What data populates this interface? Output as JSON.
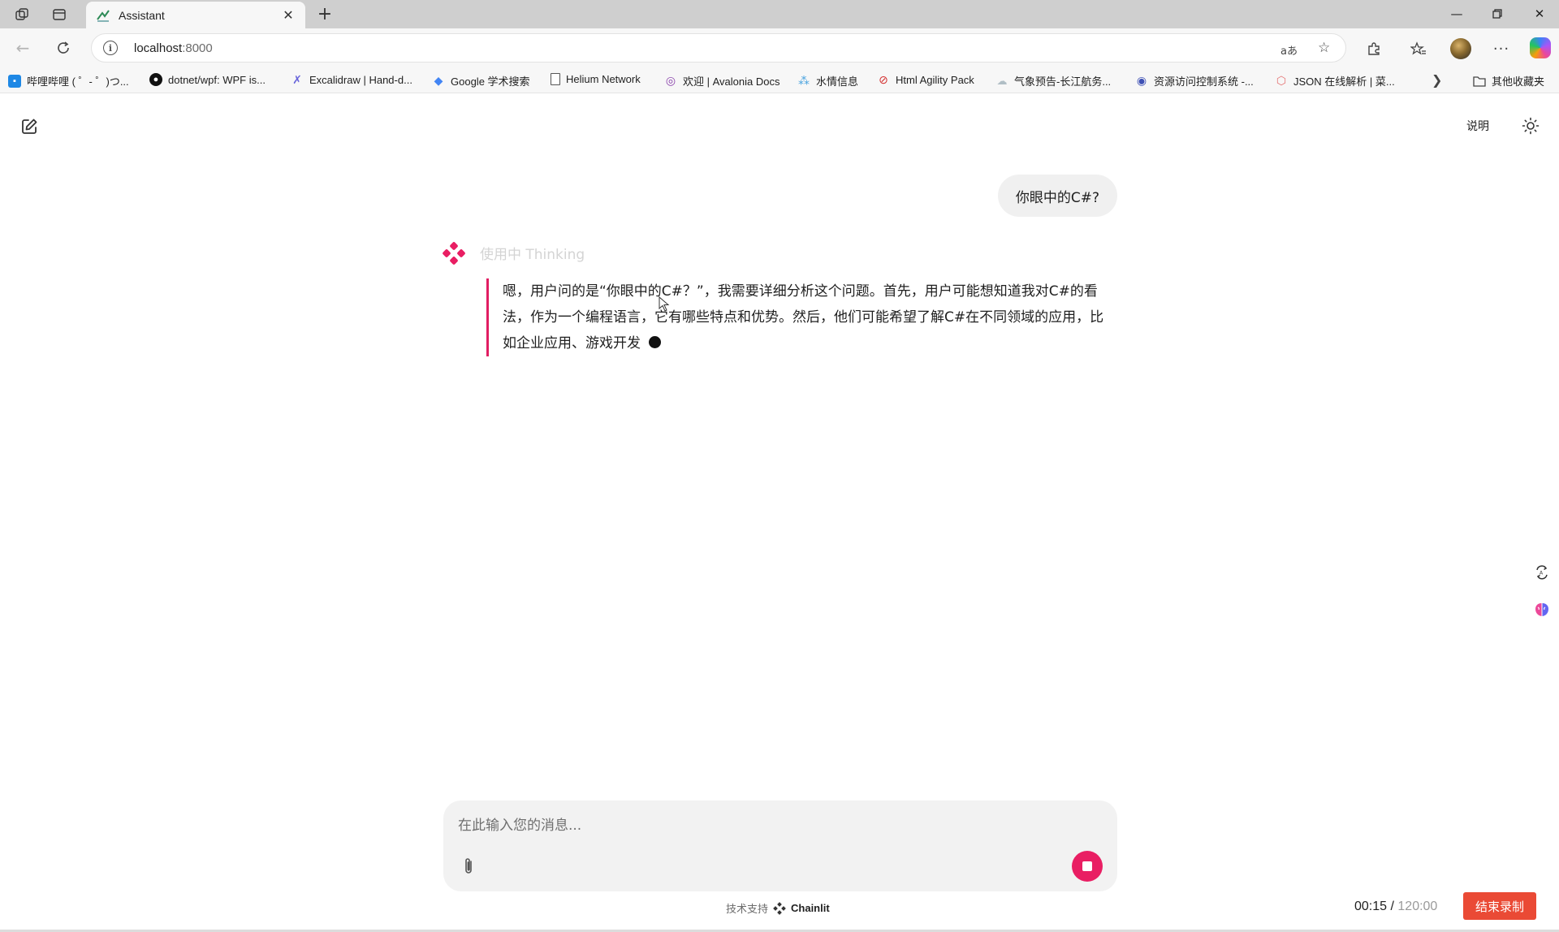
{
  "browser": {
    "tab_title": "Assistant",
    "url_host": "localhost",
    "url_port": ":8000",
    "bookmarks": [
      {
        "label": "哔哩哔哩 ( ゜- ゜)つ...",
        "icon": "bilibili-icon",
        "color": "#1e88e5"
      },
      {
        "label": "dotnet/wpf: WPF is...",
        "icon": "github-icon",
        "color": "#111111"
      },
      {
        "label": "Excalidraw | Hand-d...",
        "icon": "excalidraw-icon",
        "color": "#6965db"
      },
      {
        "label": "Google 学术搜索",
        "icon": "google-scholar-icon",
        "color": "#4285f4"
      },
      {
        "label": "Helium Network",
        "icon": "page-icon",
        "color": "#ffffff"
      },
      {
        "label": "欢迎 | Avalonia Docs",
        "icon": "avalonia-icon",
        "color": "#8b44ac"
      },
      {
        "label": "水情信息",
        "icon": "water-icon",
        "color": "#4aa3df"
      },
      {
        "label": "Html Agility Pack",
        "icon": "htmlagility-icon",
        "color": "#d32f2f"
      },
      {
        "label": "气象预告-长江航务...",
        "icon": "weather-icon",
        "color": "#cfd8dc"
      },
      {
        "label": "资源访问控制系统 -...",
        "icon": "access-control-icon",
        "color": "#3f51b5"
      },
      {
        "label": "JSON 在线解析 | 菜...",
        "icon": "json-icon",
        "color": "#e57373"
      }
    ],
    "other_bookmarks": "其他收藏夹"
  },
  "app": {
    "readme_label": "说明",
    "user_message": "你眼中的C#?",
    "thinking_label": "使用中 Thinking",
    "thinking_text": "嗯，用户问的是“你眼中的C#？”，我需要详细分析这个问题。首先，用户可能想知道我对C#的看法，作为一个编程语言，它有哪些特点和优势。然后，他们可能希望了解C#在不同领域的应用，比如企业应用、游戏开发",
    "input_placeholder": "在此输入您的消息...",
    "powered_prefix": "技术支持",
    "powered_brand": "Chainlit",
    "accent_color": "#e91e63"
  },
  "recorder": {
    "elapsed": "00:15",
    "separator": " / ",
    "total": "120:00",
    "stop_label": "结束录制"
  }
}
